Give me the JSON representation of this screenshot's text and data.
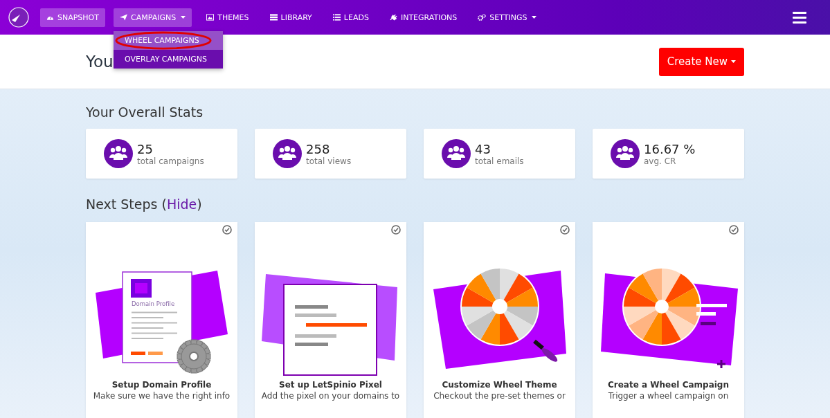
{
  "nav": {
    "items": [
      {
        "label": "SNAPSHOT",
        "active": true,
        "dropdown": false
      },
      {
        "label": "CAMPAIGNS",
        "active": true,
        "dropdown": true
      },
      {
        "label": "THEMES",
        "active": false,
        "dropdown": false
      },
      {
        "label": "LIBRARY",
        "active": false,
        "dropdown": false
      },
      {
        "label": "LEADS",
        "active": false,
        "dropdown": false
      },
      {
        "label": "INTEGRATIONS",
        "active": false,
        "dropdown": false
      },
      {
        "label": "SETTINGS",
        "active": false,
        "dropdown": true
      }
    ],
    "menu": [
      {
        "label": "WHEEL CAMPAIGNS",
        "selected": true,
        "circled": true
      },
      {
        "label": "OVERLAY CAMPAIGNS",
        "selected": false,
        "circled": false
      }
    ]
  },
  "header": {
    "title": "You",
    "button": "Create New"
  },
  "stats": {
    "title": "Your Overall Stats",
    "items": [
      {
        "value": "25",
        "label": "total campaigns"
      },
      {
        "value": "258",
        "label": "total views"
      },
      {
        "value": "43",
        "label": "total emails"
      },
      {
        "value": "16.67 %",
        "label": "avg. CR"
      }
    ]
  },
  "steps": {
    "title": "Next Steps",
    "paren_open": "(",
    "hide_link": "Hide",
    "paren_close": ")",
    "items": [
      {
        "kind": "document",
        "caption": "Domain Profile",
        "title": "Setup Domain Profile",
        "text": "Make sure we have the right info",
        "done": true
      },
      {
        "kind": "pixel",
        "title": "Set up LetSpinio Pixel",
        "text": "Add the pixel on your domains to",
        "done": true
      },
      {
        "kind": "wheel-theme",
        "title": "Customize Wheel Theme",
        "text": "Checkout the pre-set themes or",
        "done": true
      },
      {
        "kind": "wheel-campaign",
        "title": "Create a Wheel Campaign",
        "text": "Trigger a wheel campaign on",
        "done": true
      }
    ]
  }
}
